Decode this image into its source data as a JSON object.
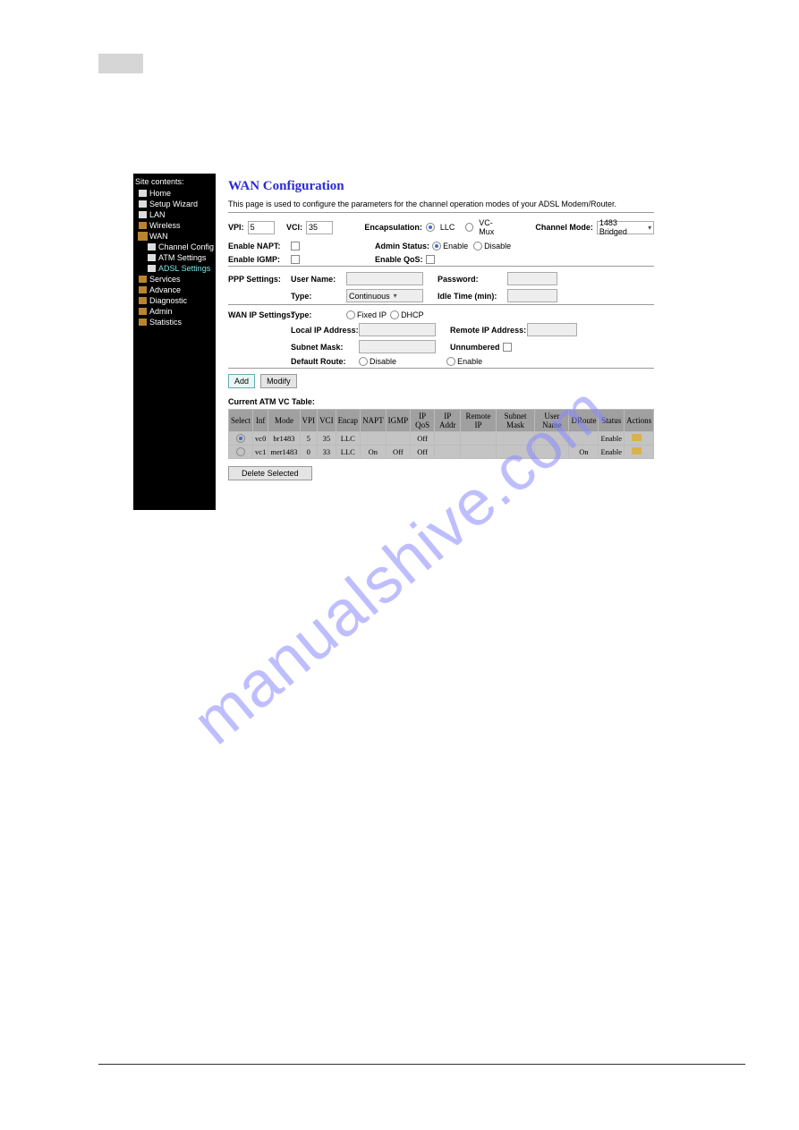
{
  "sidebar": {
    "title": "Site contents:",
    "items": [
      {
        "label": "Home",
        "type": "page"
      },
      {
        "label": "Setup Wizard",
        "type": "page"
      },
      {
        "label": "LAN",
        "type": "page"
      },
      {
        "label": "Wireless",
        "type": "folder"
      },
      {
        "label": "WAN",
        "type": "folder-open",
        "children": [
          {
            "label": "Channel Config",
            "type": "page"
          },
          {
            "label": "ATM Settings",
            "type": "page"
          },
          {
            "label": "ADSL Settings",
            "type": "page",
            "highlight": true
          }
        ]
      },
      {
        "label": "Services",
        "type": "folder"
      },
      {
        "label": "Advance",
        "type": "folder"
      },
      {
        "label": "Diagnostic",
        "type": "folder"
      },
      {
        "label": "Admin",
        "type": "folder"
      },
      {
        "label": "Statistics",
        "type": "folder"
      }
    ]
  },
  "content": {
    "heading": "WAN Configuration",
    "description": "This page is used to configure the parameters for the channel operation modes of your ADSL Modem/Router.",
    "line1": {
      "vpi_label": "VPI:",
      "vpi_value": "5",
      "vci_label": "VCI:",
      "vci_value": "35",
      "encap_label": "Encapsulation:",
      "encap_opt1": "LLC",
      "encap_opt2": "VC-Mux",
      "chmode_label": "Channel Mode:",
      "chmode_value": "1483 Bridged"
    },
    "line2": {
      "napt_label": "Enable NAPT:",
      "admin_label": "Admin Status:",
      "admin_opt1": "Enable",
      "admin_opt2": "Disable"
    },
    "line3": {
      "igmp_label": "Enable IGMP:",
      "qos_label": "Enable QoS:"
    },
    "ppp": {
      "section": "PPP Settings:",
      "user_label": "User Name:",
      "pwd_label": "Password:",
      "type_label": "Type:",
      "type_value": "Continuous",
      "idle_label": "Idle Time (min):"
    },
    "wanip": {
      "section": "WAN IP Settings:",
      "type_label": "Type:",
      "type_opt1": "Fixed IP",
      "type_opt2": "DHCP",
      "local_label": "Local IP Address:",
      "remote_label": "Remote IP Address:",
      "subnet_label": "Subnet Mask:",
      "unnum_label": "Unnumbered",
      "droute_label": "Default Route:",
      "droute_opt1": "Disable",
      "droute_opt2": "Enable"
    },
    "buttons": {
      "add": "Add",
      "modify": "Modify",
      "delete": "Delete Selected"
    },
    "table": {
      "caption": "Current ATM VC Table:",
      "headers": [
        "Select",
        "Inf",
        "Mode",
        "VPI",
        "VCI",
        "Encap",
        "NAPT",
        "IGMP",
        "IP QoS",
        "IP Addr",
        "Remote IP",
        "Subnet Mask",
        "User Name",
        "DRoute",
        "Status",
        "Actions"
      ],
      "rows": [
        {
          "select": "on",
          "inf": "vc0",
          "mode": "br1483",
          "vpi": "5",
          "vci": "35",
          "encap": "LLC",
          "napt": "",
          "igmp": "",
          "ipqos": "Off",
          "ipaddr": "",
          "remote": "",
          "subnet": "",
          "user": "",
          "droute": "",
          "status": "Enable"
        },
        {
          "select": "off",
          "inf": "vc1",
          "mode": "mer1483",
          "vpi": "0",
          "vci": "33",
          "encap": "LLC",
          "napt": "On",
          "igmp": "Off",
          "ipqos": "Off",
          "ipaddr": "",
          "remote": "",
          "subnet": "",
          "user": "",
          "droute": "On",
          "status": "Enable"
        }
      ]
    }
  },
  "watermark": "manualshive.com"
}
